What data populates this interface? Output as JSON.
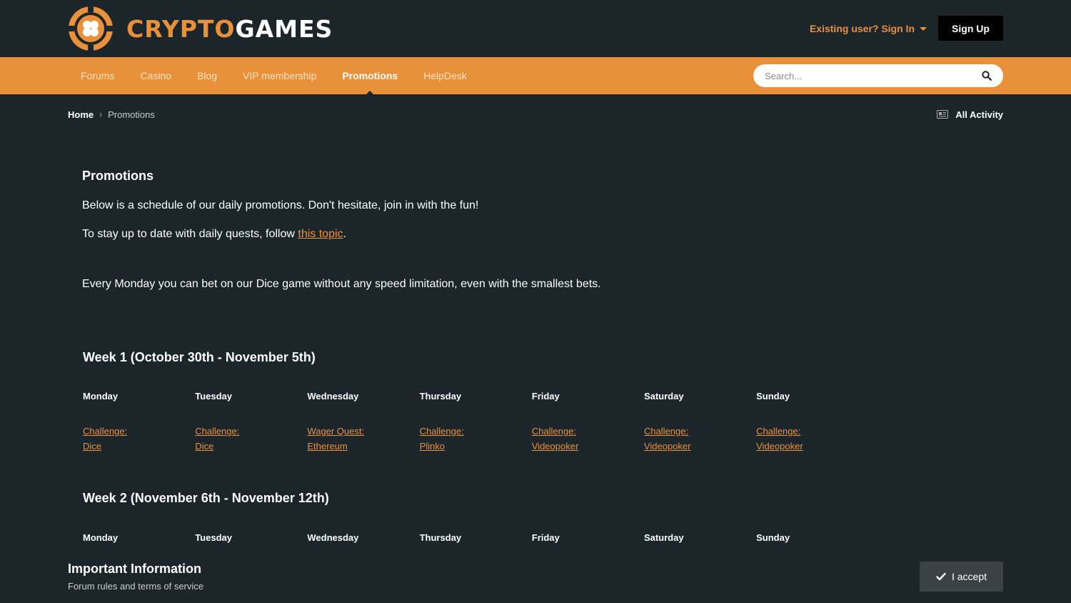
{
  "brand": {
    "part1": "CRYPTO",
    "part2": "GAMES",
    "accent": "#e8913a",
    "background": "#1c2529"
  },
  "header": {
    "signin_label": "Existing user? Sign In",
    "signup_label": "Sign Up"
  },
  "nav": {
    "items": [
      "Forums",
      "Casino",
      "Blog",
      "VIP membership",
      "Promotions",
      "HelpDesk"
    ],
    "active": "Promotions"
  },
  "search": {
    "placeholder": "Search..."
  },
  "breadcrumb": {
    "home": "Home",
    "current": "Promotions"
  },
  "activity": {
    "label": "All Activity"
  },
  "page": {
    "title": "Promotions",
    "intro": "Below is a schedule of our daily promotions. Don't hesitate, join in with the fun!",
    "follow_prefix": "To stay up to date with daily quests, follow ",
    "follow_link": "this topic",
    "follow_suffix": ".",
    "monday_note": "Every Monday you can bet on our Dice game without any speed limitation, even with the smallest bets."
  },
  "weeks": [
    {
      "title": "Week 1 (October 30th - November 5th)",
      "days": [
        "Monday",
        "Tuesday",
        "Wednesday",
        "Thursday",
        "Friday",
        "Saturday",
        "Sunday"
      ],
      "promos": [
        [
          "Challenge:",
          "Dice"
        ],
        [
          "Challenge:",
          "Dice"
        ],
        [
          "Wager Quest:",
          "Ethereum"
        ],
        [
          "Challenge:",
          "Plinko"
        ],
        [
          "Challenge:",
          "Videopoker"
        ],
        [
          "Challenge:",
          "Videopoker"
        ],
        [
          "Challenge:",
          "Videopoker"
        ]
      ]
    },
    {
      "title": "Week 2 (November 6th - November 12th)",
      "days": [
        "Monday",
        "Tuesday",
        "Wednesday",
        "Thursday",
        "Friday",
        "Saturday",
        "Sunday"
      ]
    }
  ],
  "footer": {
    "title": "Important Information",
    "subtitle": "Forum rules and terms of service",
    "accept_label": "I accept"
  }
}
